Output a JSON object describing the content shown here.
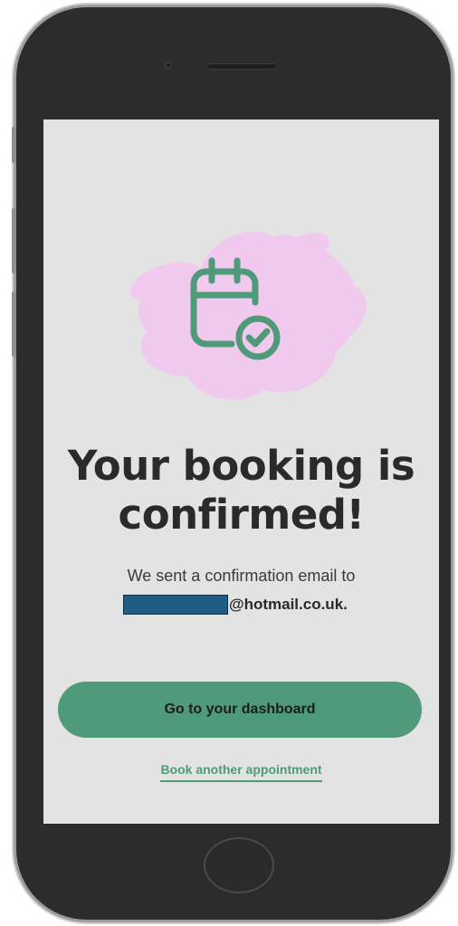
{
  "device": {
    "type": "smartphone"
  },
  "illustration": {
    "icon": "calendar-check-icon",
    "accent_color": "#4f9a78",
    "blob_color": "#f2c9ee"
  },
  "confirmation": {
    "title_line1": "Your booking is",
    "title_line2": "confirmed!",
    "sent_text": "We sent a confirmation email to",
    "email_domain": "@hotmail.co.uk."
  },
  "actions": {
    "primary_label": "Go to your dashboard",
    "secondary_label": "Book another appointment"
  },
  "colors": {
    "screen_background": "#e3e3e3",
    "primary_button": "#4f9a78",
    "text": "#2a2a2a",
    "redaction": "#1f5d85"
  }
}
